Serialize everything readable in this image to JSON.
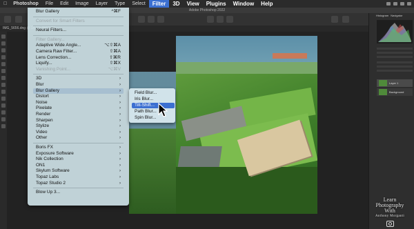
{
  "menubar": {
    "app": "Photoshop",
    "items": [
      "File",
      "Edit",
      "Image",
      "Layer",
      "Type",
      "Select",
      "Filter",
      "3D",
      "View",
      "Plugins",
      "Window",
      "Help"
    ],
    "active": "Filter"
  },
  "titlebar": "Adobe Photoshop 2022",
  "doc_tab": "IMG_5656.dng @ 14.6% (RGB/8*)",
  "filter_menu": {
    "items": [
      {
        "label": "Blur Gallery",
        "shortcut": "^⌘F",
        "type": "item"
      },
      {
        "type": "sep"
      },
      {
        "label": "Convert for Smart Filters",
        "type": "disabled"
      },
      {
        "type": "sep"
      },
      {
        "label": "Neural Filters...",
        "type": "item"
      },
      {
        "type": "sep"
      },
      {
        "label": "Filter Gallery...",
        "type": "disabled"
      },
      {
        "label": "Adaptive Wide Angle...",
        "shortcut": "⌥⇧⌘A",
        "type": "item"
      },
      {
        "label": "Camera Raw Filter...",
        "shortcut": "⇧⌘A",
        "type": "item"
      },
      {
        "label": "Lens Correction...",
        "shortcut": "⇧⌘R",
        "type": "item"
      },
      {
        "label": "Liquify...",
        "shortcut": "⇧⌘X",
        "type": "item"
      },
      {
        "label": "Vanishing Point...",
        "shortcut": "⌥⌘V",
        "type": "disabled"
      },
      {
        "type": "sep"
      },
      {
        "label": "3D",
        "type": "sub"
      },
      {
        "label": "Blur",
        "type": "sub"
      },
      {
        "label": "Blur Gallery",
        "type": "sub",
        "highlight": true
      },
      {
        "label": "Distort",
        "type": "sub"
      },
      {
        "label": "Noise",
        "type": "sub"
      },
      {
        "label": "Pixelate",
        "type": "sub"
      },
      {
        "label": "Render",
        "type": "sub"
      },
      {
        "label": "Sharpen",
        "type": "sub"
      },
      {
        "label": "Stylize",
        "type": "sub"
      },
      {
        "label": "Video",
        "type": "sub"
      },
      {
        "label": "Other",
        "type": "sub"
      },
      {
        "type": "sep"
      },
      {
        "label": "Boris FX",
        "type": "sub"
      },
      {
        "label": "Exposure Software",
        "type": "sub"
      },
      {
        "label": "Nik Collection",
        "type": "sub"
      },
      {
        "label": "ON1",
        "type": "sub"
      },
      {
        "label": "Skylum Software",
        "type": "sub"
      },
      {
        "label": "Topaz Labs",
        "type": "sub"
      },
      {
        "label": "Topaz Studio 2",
        "type": "sub"
      },
      {
        "type": "sep"
      },
      {
        "label": "Blow Up 3...",
        "type": "item"
      }
    ]
  },
  "blur_gallery_submenu": {
    "items": [
      "Field Blur...",
      "Iris Blur...",
      "Tilt-Shift...",
      "Path Blur...",
      "Spin Blur..."
    ],
    "selected": "Tilt-Shift..."
  },
  "panels": {
    "tabs": [
      "Histogram",
      "Navigator"
    ],
    "layers": [
      "Layer 1",
      "Background"
    ]
  },
  "watermark": {
    "line1": "Learn",
    "line2": "Photography",
    "line3": "With",
    "line4": "Anthony Morganti"
  },
  "colors": {
    "menu_bg": "#d2e6eb",
    "highlight": "#3b6fd1",
    "ui_dark": "#2b2b2b"
  }
}
